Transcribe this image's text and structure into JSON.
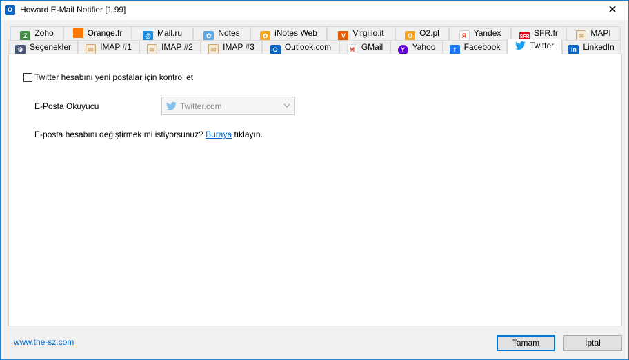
{
  "window": {
    "title": "Howard E-Mail Notifier [1.99]",
    "close_symbol": "✕"
  },
  "tabs_row1": [
    {
      "label": "Zoho",
      "icon": "zoho-icon",
      "color": "#3d8b40"
    },
    {
      "label": "Orange.fr",
      "icon": "orange-icon",
      "color": "#ff7900"
    },
    {
      "label": "Mail.ru",
      "icon": "mailru-icon",
      "color": "#168de2"
    },
    {
      "label": "Notes",
      "icon": "notes-icon",
      "color": "#5aa9e6"
    },
    {
      "label": "iNotes Web",
      "icon": "inotes-icon",
      "color": "#f2a51a"
    },
    {
      "label": "Virgilio.it",
      "icon": "virgilio-icon",
      "color": "#e05a00"
    },
    {
      "label": "O2.pl",
      "icon": "o2-icon",
      "color": "#f5a623"
    },
    {
      "label": "Yandex",
      "icon": "yandex-icon",
      "color": "#e61400"
    },
    {
      "label": "SFR.fr",
      "icon": "sfr-icon",
      "color": "#e2001a"
    },
    {
      "label": "MAPI",
      "icon": "envelope-icon",
      "color": "#c8a46e"
    }
  ],
  "tabs_row2": [
    {
      "label": "Seçenekler",
      "icon": "settings-icon",
      "color": "#4a5a78"
    },
    {
      "label": "IMAP #1",
      "icon": "envelope-icon",
      "color": "#c8a46e"
    },
    {
      "label": "IMAP #2",
      "icon": "envelope-icon",
      "color": "#c8a46e"
    },
    {
      "label": "IMAP #3",
      "icon": "envelope-icon",
      "color": "#c8a46e"
    },
    {
      "label": "Outlook.com",
      "icon": "outlook-icon",
      "color": "#0a64c4"
    },
    {
      "label": "GMail",
      "icon": "gmail-icon",
      "color": "#d93025"
    },
    {
      "label": "Yahoo",
      "icon": "yahoo-icon",
      "color": "#6001d2"
    },
    {
      "label": "Facebook",
      "icon": "facebook-icon",
      "color": "#1877f2"
    },
    {
      "label": "Twitter",
      "icon": "twitter-icon",
      "color": "#1da1f2",
      "active": true
    },
    {
      "label": "LinkedIn",
      "icon": "linkedin-icon",
      "color": "#0a66c2"
    }
  ],
  "panel": {
    "check_label": "Twitter hesabını yeni postalar için kontrol et",
    "check_checked": false,
    "reader_label": "E-Posta Okuyucu",
    "reader_value": "Twitter.com",
    "change_prefix": "E-posta hesabını değiştirmek mi istiyorsunuz?",
    "change_link": "Buraya",
    "change_suffix": "tıklayın."
  },
  "footer": {
    "link": "www.the-sz.com",
    "ok": "Tamam",
    "cancel": "İptal"
  }
}
